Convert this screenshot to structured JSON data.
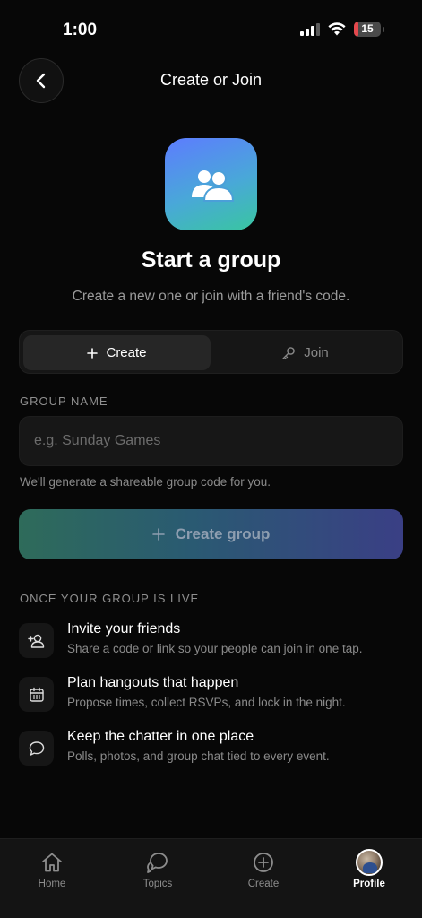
{
  "status_bar": {
    "time": "1:00",
    "battery": "15"
  },
  "nav": {
    "title": "Create or Join"
  },
  "hero": {
    "title": "Start a group",
    "subtitle": "Create a new one or join with a friend's code."
  },
  "mode_tabs": [
    {
      "label": "Create",
      "icon": "plus-icon",
      "selected": true
    },
    {
      "label": "Join",
      "icon": "key-icon",
      "selected": false
    }
  ],
  "form": {
    "group_name_label": "GROUP NAME",
    "group_name_placeholder": "e.g. Sunday Games",
    "group_name_value": "",
    "helper": "We'll generate a shareable group code for you.",
    "submit_label": "Create group"
  },
  "features": {
    "heading": "ONCE YOUR GROUP IS LIVE",
    "items": [
      {
        "icon": "add-person-icon",
        "title": "Invite your friends",
        "desc": "Share a code or link so your people can join in one tap."
      },
      {
        "icon": "calendar-icon",
        "title": "Plan hangouts that happen",
        "desc": "Propose times, collect RSVPs, and lock in the night."
      },
      {
        "icon": "chat-bubble-icon",
        "title": "Keep the chatter in one place",
        "desc": "Polls, photos, and group chat tied to every event."
      }
    ]
  },
  "tab_bar": [
    {
      "label": "Home",
      "icon": "home-icon",
      "active": false
    },
    {
      "label": "Topics",
      "icon": "topics-icon",
      "active": false
    },
    {
      "label": "Create",
      "icon": "plus-circle-icon",
      "active": false
    },
    {
      "label": "Profile",
      "icon": "avatar",
      "active": true
    }
  ],
  "colors": {
    "background": "#070707",
    "accent_start": "#2e6b5a",
    "accent_end": "#3a3f85",
    "battery_low": "#e5484d"
  }
}
